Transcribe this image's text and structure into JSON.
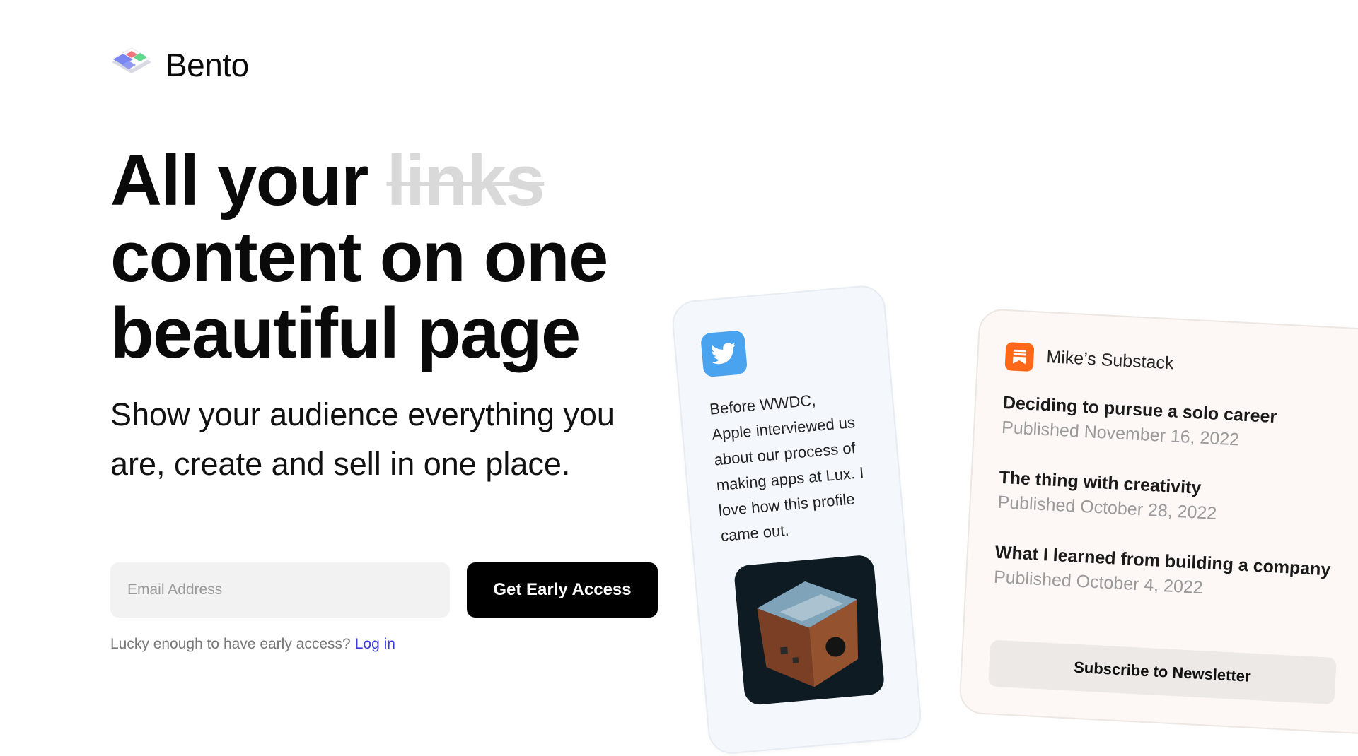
{
  "header": {
    "brand": "Bento"
  },
  "hero": {
    "headline_start": "All your ",
    "headline_struck": "links",
    "headline_rest": "content on one beautiful page",
    "subline": "Show your audience everything you are, create and sell in one place."
  },
  "form": {
    "email_placeholder": "Email Address",
    "cta_label": "Get Early Access",
    "note_text": "Lucky enough to have early access?",
    "login_label": "Log in"
  },
  "tweet_card": {
    "icon": "twitter-bird-icon",
    "text": "Before WWDC, Apple interviewed us about our process of making apps at Lux. I love how this profile came out."
  },
  "substack_card": {
    "icon": "substack-icon",
    "title": "Mike’s Substack",
    "posts": [
      {
        "title": "Deciding to pursue a solo career",
        "date": "Published November 16, 2022"
      },
      {
        "title": "The thing with creativity",
        "date": "Published October 28, 2022"
      },
      {
        "title": "What I learned from building a company",
        "date": "Published October 4, 2022"
      }
    ],
    "subscribe_label": "Subscribe to Newsletter"
  },
  "colors": {
    "accent_twitter": "#4aa3ee",
    "accent_substack": "#ff6719",
    "cta_bg": "#000000",
    "link": "#3b3bdc"
  }
}
